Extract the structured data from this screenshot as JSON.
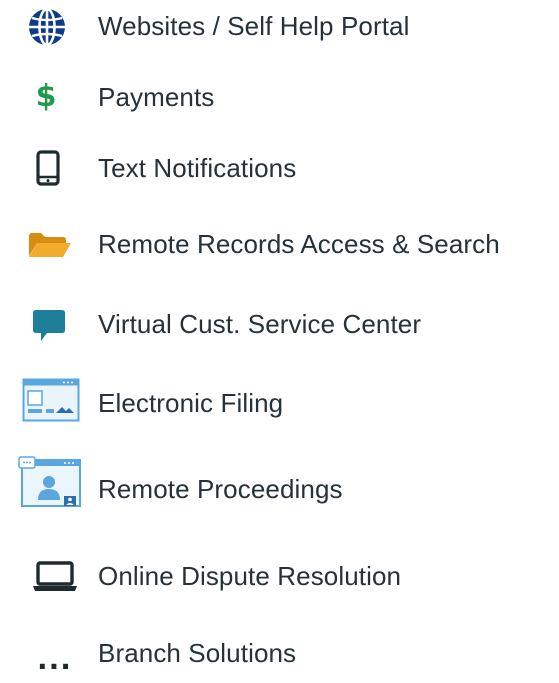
{
  "menu": {
    "items": [
      {
        "label": "Websites / Self Help Portal",
        "icon": "globe-icon"
      },
      {
        "label": "Payments",
        "icon": "dollar-icon",
        "glyph": "$"
      },
      {
        "label": "Text Notifications",
        "icon": "mobile-phone-icon"
      },
      {
        "label": "Remote Records Access &  Search",
        "icon": "folder-open-icon"
      },
      {
        "label": "Virtual  Cust. Service Center",
        "icon": "speech-bubble-icon"
      },
      {
        "label": "Electronic Filing",
        "icon": "web-window-icon"
      },
      {
        "label": "Remote Proceedings",
        "icon": "video-user-window-icon"
      },
      {
        "label": "Online Dispute Resolution",
        "icon": "laptop-icon"
      },
      {
        "label": "Branch Solutions",
        "icon": "ellipsis-icon",
        "glyph": "..."
      }
    ]
  },
  "colors": {
    "text": "#263238",
    "globe": "#0d3b8c",
    "dollar": "#1f9a4c",
    "folder": "#f0a92a",
    "chat": "#1e7f9a",
    "window_blue": "#5aa7e0"
  }
}
